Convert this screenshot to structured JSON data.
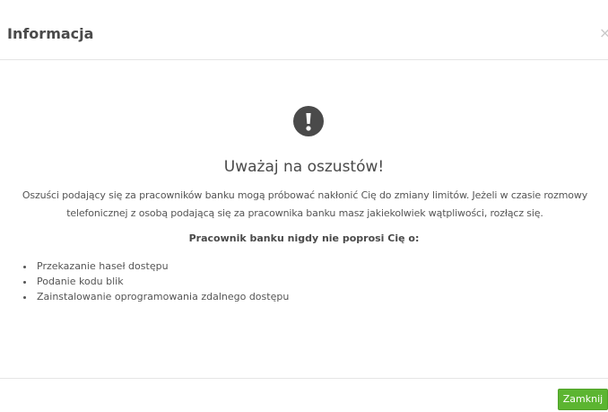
{
  "header": {
    "title": "Informacja",
    "close_glyph": "×"
  },
  "body": {
    "icon": "exclamation-circle-icon",
    "title": "Uważaj na oszustów!",
    "text": "Oszuści podający się za pracowników banku mogą próbować nakłonić Cię do zmiany limitów. Jeżeli w czasie rozmowy telefonicznej z osobą podającą się za pracownika banku masz jakiekolwiek wątpliwości, rozłącz się.",
    "subtitle": "Pracownik banku nigdy nie poprosi Cię o:",
    "items": [
      "Przekazanie haseł dostępu",
      "Podanie kodu blik",
      "Zainstalowanie oprogramowania zdalnego dostępu"
    ]
  },
  "footer": {
    "close_label": "Zamknij"
  },
  "colors": {
    "accent": "#5cb531",
    "icon": "#4a4a4a",
    "text": "#555555"
  }
}
